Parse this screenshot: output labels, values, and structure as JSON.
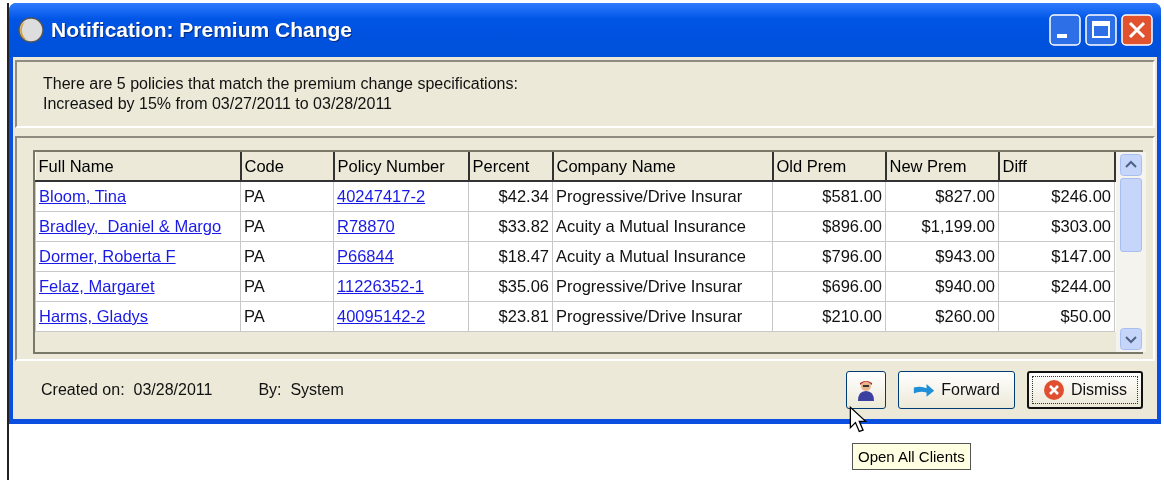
{
  "window": {
    "title": "Notification: Premium Change"
  },
  "message": [
    "There are 5 policies that match the premium change specifications:",
    "Increased by 15% from 03/27/2011 to 03/28/2011"
  ],
  "table": {
    "columns": [
      {
        "label": "Full Name",
        "kind": "link"
      },
      {
        "label": "Code",
        "kind": "text"
      },
      {
        "label": "Policy Number",
        "kind": "link"
      },
      {
        "label": "Percent",
        "kind": "amount"
      },
      {
        "label": "Company Name",
        "kind": "text"
      },
      {
        "label": "Old Prem",
        "kind": "amount"
      },
      {
        "label": "New Prem",
        "kind": "amount"
      },
      {
        "label": "Diff",
        "kind": "amount"
      }
    ],
    "rows": [
      [
        "Bloom, Tina",
        "PA",
        "40247417-2",
        "$42.34",
        "Progressive/Drive Insurar",
        "$581.00",
        "$827.00",
        "$246.00"
      ],
      [
        "Bradley,  Daniel & Margo",
        "PA",
        "R78870",
        "$33.82",
        "Acuity a Mutual Insurance",
        "$896.00",
        "$1,199.00",
        "$303.00"
      ],
      [
        "Dormer, Roberta F",
        "PA",
        "P66844",
        "$18.47",
        "Acuity a Mutual Insurance",
        "$796.00",
        "$943.00",
        "$147.00"
      ],
      [
        "Felaz, Margaret",
        "PA",
        "11226352-1",
        "$35.06",
        "Progressive/Drive Insurar",
        "$696.00",
        "$940.00",
        "$244.00"
      ],
      [
        "Harms, Gladys",
        "PA",
        "40095142-2",
        "$23.81",
        "Progressive/Drive Insurar",
        "$210.00",
        "$260.00",
        "$50.00"
      ]
    ]
  },
  "footer": {
    "created": "Created on:  03/28/2011",
    "by": "By:  System",
    "buttons": [
      {
        "kind": "clients",
        "default": false
      },
      {
        "kind": "forward",
        "label": "Forward",
        "default": false
      },
      {
        "kind": "dismiss",
        "label": "Dismiss",
        "default": true
      }
    ]
  },
  "tooltip": "Open All Clients"
}
